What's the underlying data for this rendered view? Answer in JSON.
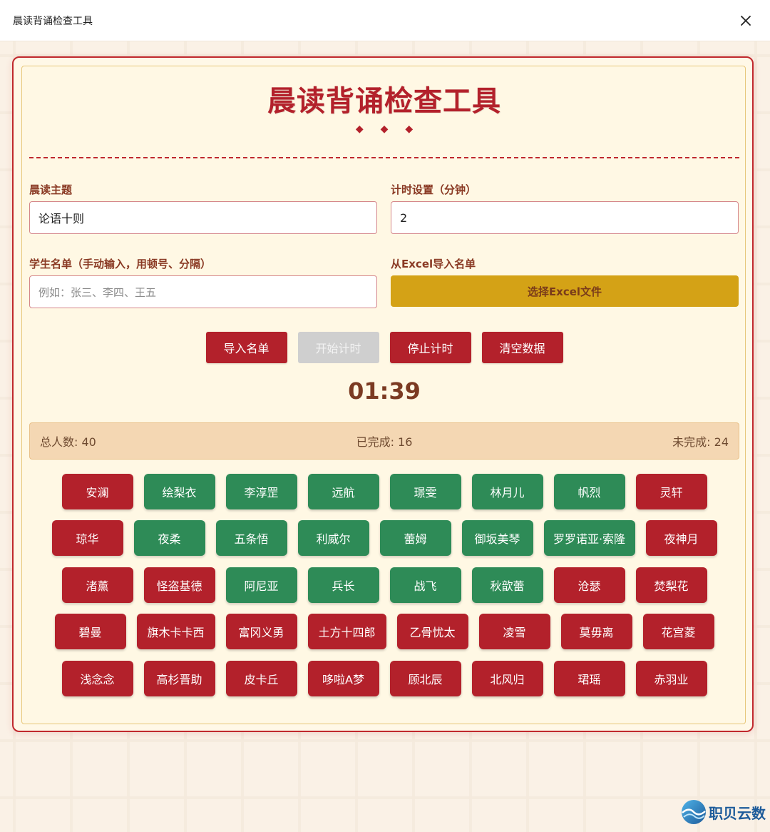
{
  "window": {
    "title": "晨读背诵检查工具"
  },
  "header": {
    "title": "晨读背诵检查工具",
    "ornament": "◆◆◆"
  },
  "form": {
    "topic_label": "晨读主题",
    "topic_value": "论语十则",
    "timer_label": "计时设置（分钟）",
    "timer_value": "2",
    "students_label": "学生名单（手动输入，用顿号、分隔）",
    "students_placeholder": "例如：张三、李四、王五",
    "excel_label": "从Excel导入名单",
    "excel_button": "选择Excel文件"
  },
  "actions": {
    "import": "导入名单",
    "start": "开始计时",
    "stop": "停止计时",
    "clear": "清空数据"
  },
  "timer": {
    "display": "01:39"
  },
  "stats": {
    "total": "总人数: 40",
    "done": "已完成: 16",
    "pending": "未完成: 24"
  },
  "colors": {
    "pending": "#b3212b",
    "done": "#2e8b57",
    "excel": "#d4a216",
    "stats_bg": "#f4d7b3"
  },
  "students": [
    [
      {
        "name": "安澜",
        "status": "pending"
      },
      {
        "name": "绘梨衣",
        "status": "done"
      },
      {
        "name": "李淳罡",
        "status": "done"
      },
      {
        "name": "远航",
        "status": "done"
      },
      {
        "name": "璟雯",
        "status": "done"
      },
      {
        "name": "林月儿",
        "status": "done"
      },
      {
        "name": "帆烈",
        "status": "done"
      },
      {
        "name": "灵轩",
        "status": "pending"
      }
    ],
    [
      {
        "name": "琼华",
        "status": "pending"
      },
      {
        "name": "夜柔",
        "status": "done"
      },
      {
        "name": "五条悟",
        "status": "done"
      },
      {
        "name": "利威尔",
        "status": "done"
      },
      {
        "name": "蕾姆",
        "status": "done"
      },
      {
        "name": "御坂美琴",
        "status": "done"
      },
      {
        "name": "罗罗诺亚·索隆",
        "status": "done"
      },
      {
        "name": "夜神月",
        "status": "pending"
      }
    ],
    [
      {
        "name": "渚薰",
        "status": "pending"
      },
      {
        "name": "怪盗基德",
        "status": "pending"
      },
      {
        "name": "阿尼亚",
        "status": "done"
      },
      {
        "name": "兵长",
        "status": "done"
      },
      {
        "name": "战飞",
        "status": "done"
      },
      {
        "name": "秋歆蕾",
        "status": "done"
      },
      {
        "name": "沧瑟",
        "status": "pending"
      },
      {
        "name": "焚梨花",
        "status": "pending"
      }
    ],
    [
      {
        "name": "碧曼",
        "status": "pending"
      },
      {
        "name": "旗木卡卡西",
        "status": "pending"
      },
      {
        "name": "富冈义勇",
        "status": "pending"
      },
      {
        "name": "土方十四郎",
        "status": "pending"
      },
      {
        "name": "乙骨忧太",
        "status": "pending"
      },
      {
        "name": "凌雪",
        "status": "pending"
      },
      {
        "name": "莫毋离",
        "status": "pending"
      },
      {
        "name": "花宫菱",
        "status": "pending"
      }
    ],
    [
      {
        "name": "浅念念",
        "status": "pending"
      },
      {
        "name": "高杉晋助",
        "status": "pending"
      },
      {
        "name": "皮卡丘",
        "status": "pending"
      },
      {
        "name": "哆啦A梦",
        "status": "pending"
      },
      {
        "name": "顾北辰",
        "status": "pending"
      },
      {
        "name": "北风归",
        "status": "pending"
      },
      {
        "name": "珺瑶",
        "status": "pending"
      },
      {
        "name": "赤羽业",
        "status": "pending"
      }
    ]
  ],
  "logo": {
    "text": "职贝云数",
    "icon": "globe-wave-icon"
  }
}
